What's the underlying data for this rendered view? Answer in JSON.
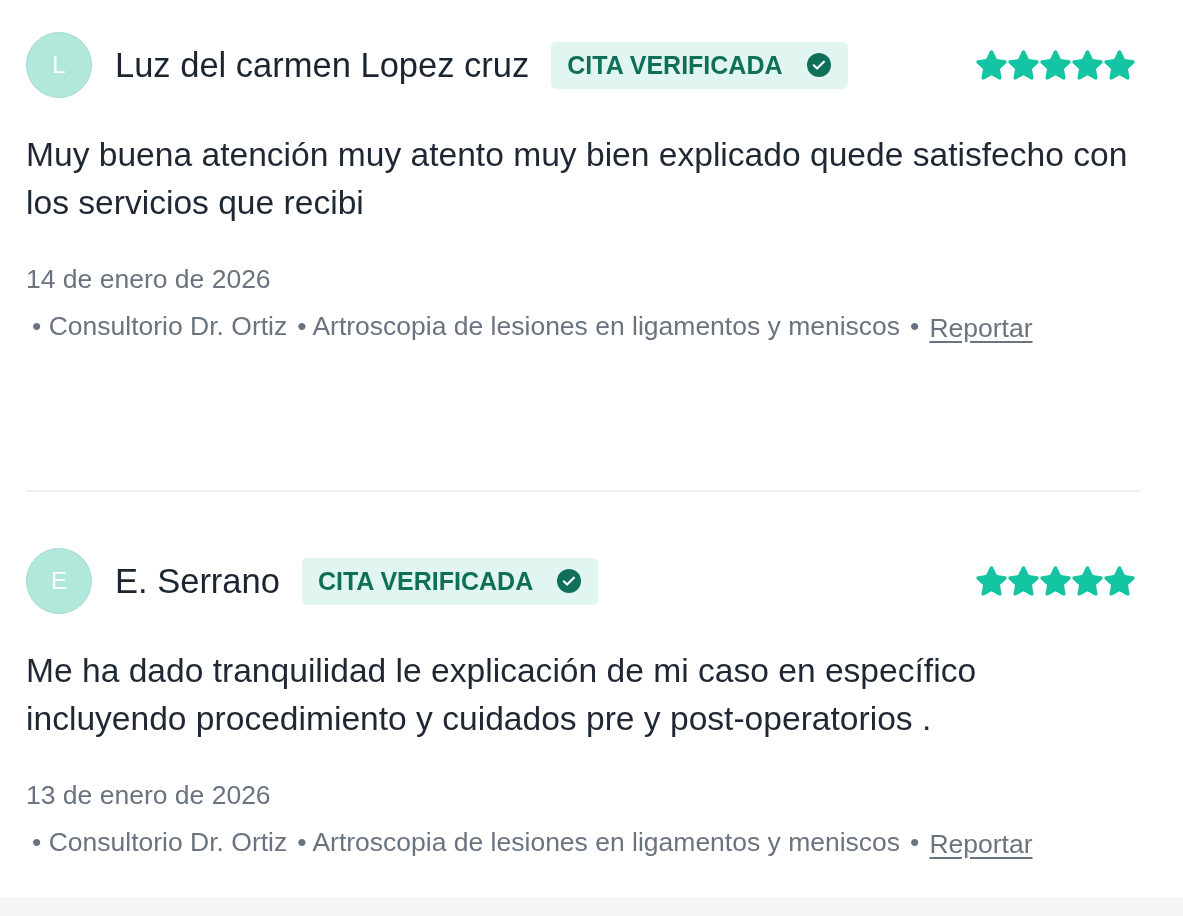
{
  "reviews": [
    {
      "avatar_initial": "L",
      "name": "Luz del carmen Lopez cruz",
      "badge": "CITA VERIFICADA",
      "stars": 5,
      "text": "Muy buena atención muy atento muy bien explicado quede satisfecho con los servicios que recibi",
      "date": "14 de enero de 2026",
      "meta": [
        {
          "kind": "text",
          "text": "• Consultorio Dr. Ortiz"
        },
        {
          "kind": "text",
          "text": "• Artroscopia de lesiones en ligamentos y meniscos"
        },
        {
          "kind": "text",
          "text": "•"
        },
        {
          "kind": "link",
          "text": "Reportar"
        }
      ]
    },
    {
      "avatar_initial": "E",
      "name": "E. Serrano",
      "badge": "CITA VERIFICADA",
      "stars": 5,
      "text": "Me ha dado tranquilidad le explicación de mi caso en específico incluyendo procedimiento y cuidados pre y post-operatorios .",
      "date": "13 de enero de 2026",
      "meta": [
        {
          "kind": "text",
          "text": "• Consultorio Dr. Ortiz"
        },
        {
          "kind": "text",
          "text": "• Artroscopia de lesiones en ligamentos y meniscos"
        },
        {
          "kind": "text",
          "text": "•"
        },
        {
          "kind": "link",
          "text": "Reportar"
        }
      ]
    }
  ]
}
